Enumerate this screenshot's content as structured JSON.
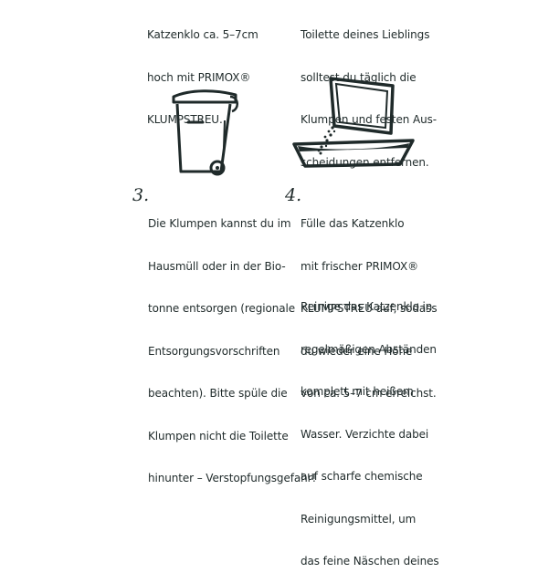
{
  "col_left_top": {
    "lines": [
      "Katzenklo ca. 5–7cm",
      "hoch mit PRIMOX®",
      "KLUMPSTREU."
    ]
  },
  "col_right_top": {
    "lines": [
      "Toilette deines Lieblings",
      "solltest du täglich die",
      "Klumpen und festen Aus-",
      "scheidungen entfernen."
    ]
  },
  "step3": {
    "number": "3.",
    "lines": [
      "Die Klumpen kannst du im",
      "Hausmüll oder in der Bio-",
      "tonne entsorgen (regionale",
      "Entsorgungsvorschriften",
      "beachten). Bitte spüle die",
      "Klumpen nicht die Toilette",
      "hinunter – Verstopfungsgefahr!"
    ]
  },
  "step4": {
    "number": "4.",
    "lines": [
      "Fülle das Katzenklo",
      "mit frischer PRIMOX®",
      "KLUMPSTREU auf, sodass",
      "du wieder eine Höhe",
      "von ca. 5–7 cm erreichst."
    ]
  },
  "cleaning": {
    "lines": [
      "Reinige das Katzenklo in",
      "regelmäßigen Abständen",
      "komplett mit heißem",
      "Wasser. Verzichte dabei",
      "auf scharfe chemische",
      "Reinigungsmittel, um",
      "das feine Näschen deines"
    ]
  },
  "icons": {
    "left": "trash-bin-icon",
    "right": "litter-pouring-icon"
  },
  "colors": {
    "ink": "#1f2a2a",
    "background": "#ffffff"
  }
}
